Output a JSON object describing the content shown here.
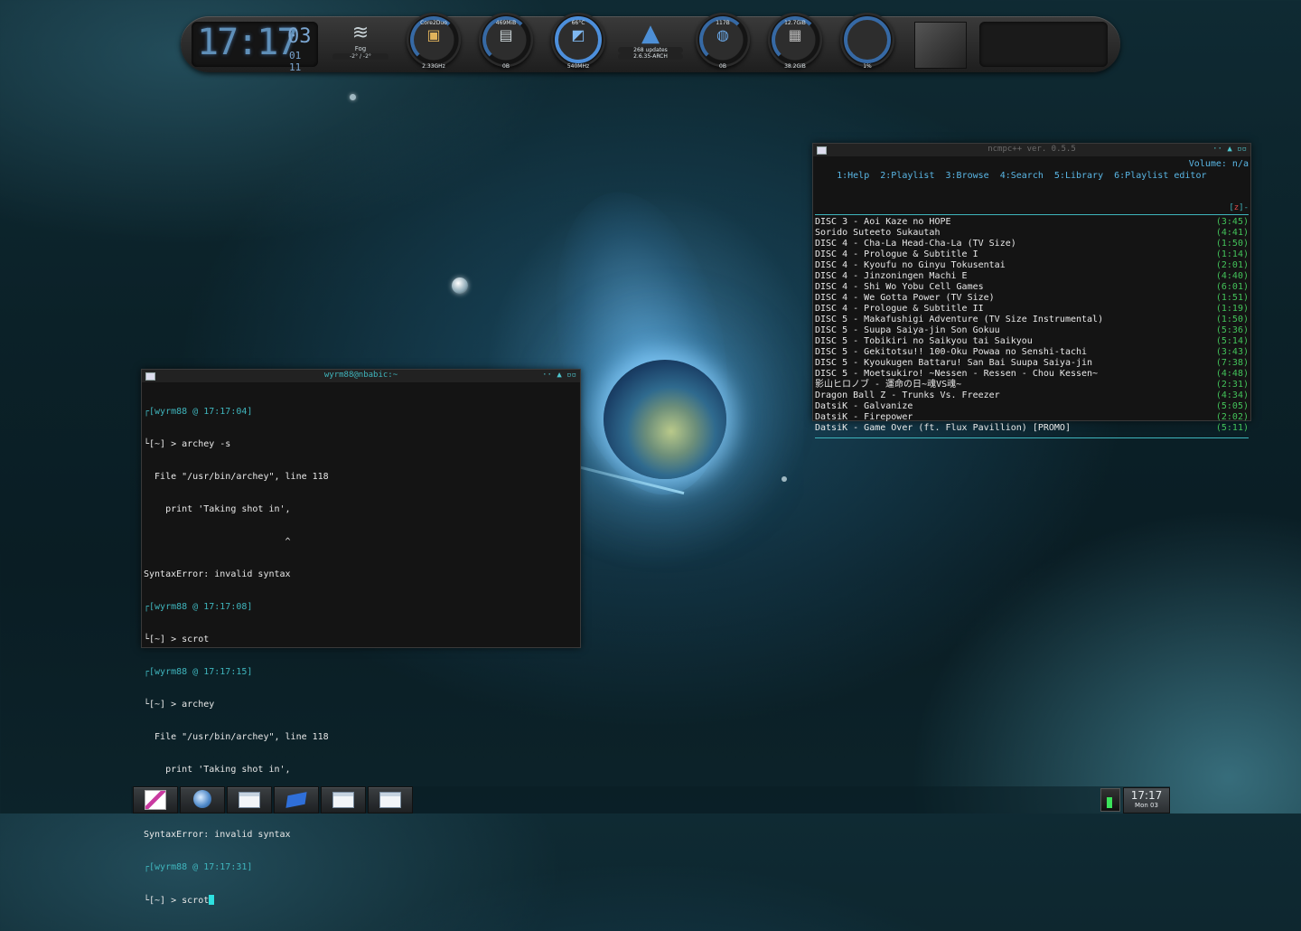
{
  "dock": {
    "clock": {
      "hm": "17:17",
      "seconds": "03",
      "date": "01 11"
    },
    "weather": {
      "icon": "fog-icon",
      "condition": "Fog",
      "temps": "-2° / -2°"
    },
    "gauges": [
      {
        "name": "cpu",
        "top": "Core2Duo",
        "bottom": "2.33GHz",
        "glyph": "▣"
      },
      {
        "name": "ram",
        "top": "469MiB",
        "bottom": "0B",
        "glyph": "▤"
      },
      {
        "name": "gpu",
        "top": "66°C",
        "bottom": "540MHz",
        "glyph": "◩"
      },
      {
        "name": "net",
        "top": "117B",
        "bottom": "0B",
        "glyph": "◍"
      },
      {
        "name": "disk",
        "top": "12.7GiB",
        "bottom": "38.2GiB",
        "glyph": "▦"
      },
      {
        "name": "volume",
        "top": "",
        "bottom": "1%",
        "glyph": ""
      }
    ],
    "arch": {
      "updates": "268 updates",
      "kernel": "2.6.35-ARCH"
    }
  },
  "terminal": {
    "title": "wyrm88@nbabic:~",
    "buttons": "·· ▲ ▫▫",
    "lines": [
      {
        "text": "┌[wyrm88 @ 17:17:04]",
        "cls": "cy"
      },
      {
        "text": "└[~] > archey -s",
        "cls": ""
      },
      {
        "text": "  File \"/usr/bin/archey\", line 118",
        "cls": ""
      },
      {
        "text": "    print 'Taking shot in',",
        "cls": ""
      },
      {
        "text": "                          ^",
        "cls": ""
      },
      {
        "text": "SyntaxError: invalid syntax",
        "cls": ""
      },
      {
        "text": "┌[wyrm88 @ 17:17:08]",
        "cls": "cy"
      },
      {
        "text": "└[~] > scrot",
        "cls": ""
      },
      {
        "text": "┌[wyrm88 @ 17:17:15]",
        "cls": "cy"
      },
      {
        "text": "└[~] > archey",
        "cls": ""
      },
      {
        "text": "  File \"/usr/bin/archey\", line 118",
        "cls": ""
      },
      {
        "text": "    print 'Taking shot in',",
        "cls": ""
      },
      {
        "text": "                          ^",
        "cls": ""
      },
      {
        "text": "SyntaxError: invalid syntax",
        "cls": ""
      },
      {
        "text": "┌[wyrm88 @ 17:17:31]",
        "cls": "cy"
      }
    ],
    "prompt": "└[~] > scrot"
  },
  "ncmpc": {
    "title": "ncmpc++ ver. 0.5.5",
    "buttons": "·· ▲ ▫▫",
    "menu": "1:Help  2:Playlist  3:Browse  4:Search  5:Library  6:Playlist editor",
    "volume": "Volume: n/a",
    "flag": "z",
    "songs": [
      {
        "title": "DISC 3 - Aoi Kaze no HOPE",
        "dur": "(3:45)"
      },
      {
        "title": "Sorido Suteeto Sukautah",
        "dur": "(4:41)"
      },
      {
        "title": "DISC 4 - Cha-La Head-Cha-La (TV Size)",
        "dur": "(1:50)"
      },
      {
        "title": "DISC 4 - Prologue & Subtitle I",
        "dur": "(1:14)"
      },
      {
        "title": "DISC 4 - Kyoufu no Ginyu Tokusentai",
        "dur": "(2:01)"
      },
      {
        "title": "DISC 4 - Jinzoningen Machi E",
        "dur": "(4:40)"
      },
      {
        "title": "DISC 4 - Shi Wo Yobu Cell Games",
        "dur": "(6:01)"
      },
      {
        "title": "DISC 4 - We Gotta Power (TV Size)",
        "dur": "(1:51)"
      },
      {
        "title": "DISC 4 - Prologue & Subtitle II",
        "dur": "(1:19)"
      },
      {
        "title": "DISC 5 - Makafushigi Adventure (TV Size Instrumental)",
        "dur": "(1:50)"
      },
      {
        "title": "DISC 5 - Suupa Saiya-jin Son Gokuu",
        "dur": "(5:36)"
      },
      {
        "title": "DISC 5 - Tobikiri no Saikyou tai Saikyou",
        "dur": "(5:14)"
      },
      {
        "title": "DISC 5 - Gekitotsu!! 100-Oku Powaa no Senshi-tachi",
        "dur": "(3:43)"
      },
      {
        "title": "DISC 5 - Kyoukugen Battaru! San Bai Suupa Saiya-jin",
        "dur": "(7:38)"
      },
      {
        "title": "DISC 5 - Moetsukiro! ~Nessen - Ressen - Chou Kessen~",
        "dur": "(4:48)"
      },
      {
        "title": "影山ヒロノブ - 運命の日~魂VS魂~",
        "dur": "(2:31)"
      },
      {
        "title": "Dragon Ball Z - Trunks Vs. Freezer",
        "dur": "(4:34)"
      },
      {
        "title": "DatsiK - Galvanize",
        "dur": "(5:05)"
      },
      {
        "title": "DatsiK - Firepower",
        "dur": "(2:02)"
      },
      {
        "title": "DatsiK - Game Over (ft. Flux Pavillion) [PROMO]",
        "dur": "(5:11)"
      }
    ]
  },
  "taskbar": {
    "tasks": [
      {
        "name": "task-image-viewer",
        "icon": "pic"
      },
      {
        "name": "task-browser",
        "icon": "globe"
      },
      {
        "name": "task-window-1",
        "icon": "win-ico"
      },
      {
        "name": "task-blue-app",
        "icon": "blue"
      },
      {
        "name": "task-window-2",
        "icon": "win-ico"
      },
      {
        "name": "task-window-3",
        "icon": "win-ico"
      }
    ],
    "clock": {
      "time": "17:17",
      "date": "Mon 03"
    }
  }
}
